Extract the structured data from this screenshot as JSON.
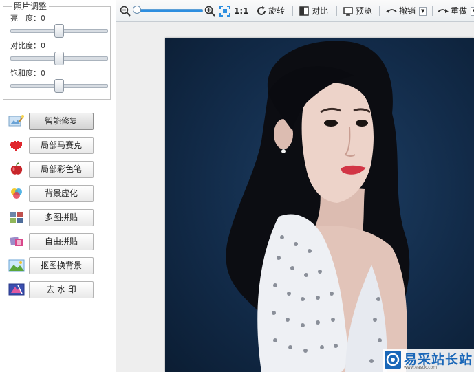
{
  "adjust": {
    "title": "照片调整",
    "brightness": {
      "label": "亮　度：",
      "value": "0"
    },
    "contrast": {
      "label": "对比度：",
      "value": "0"
    },
    "saturation": {
      "label": "饱和度：",
      "value": "0"
    }
  },
  "tools": [
    {
      "label": "智能修复",
      "icon": "magic-wand-icon"
    },
    {
      "label": "局部马赛克",
      "icon": "mosaic-heart-icon"
    },
    {
      "label": "局部彩色笔",
      "icon": "apple-icon"
    },
    {
      "label": "背景虚化",
      "icon": "color-blur-icon"
    },
    {
      "label": "多图拼贴",
      "icon": "collage-icon"
    },
    {
      "label": "自由拼贴",
      "icon": "free-collage-icon"
    },
    {
      "label": "抠图换背景",
      "icon": "landscape-icon"
    },
    {
      "label": "去 水 印",
      "icon": "watermark-remove-icon"
    }
  ],
  "toolbar": {
    "actual_size": "1:1",
    "rotate": "旋转",
    "compare": "对比",
    "preview": "预览",
    "undo": "撤销",
    "redo": "重做"
  },
  "watermark": {
    "text": "易采站长站",
    "sub": "www.easck.com"
  },
  "colors": {
    "accent": "#2d8ee0",
    "background": "#122b49",
    "watermark": "#1a67b8"
  }
}
